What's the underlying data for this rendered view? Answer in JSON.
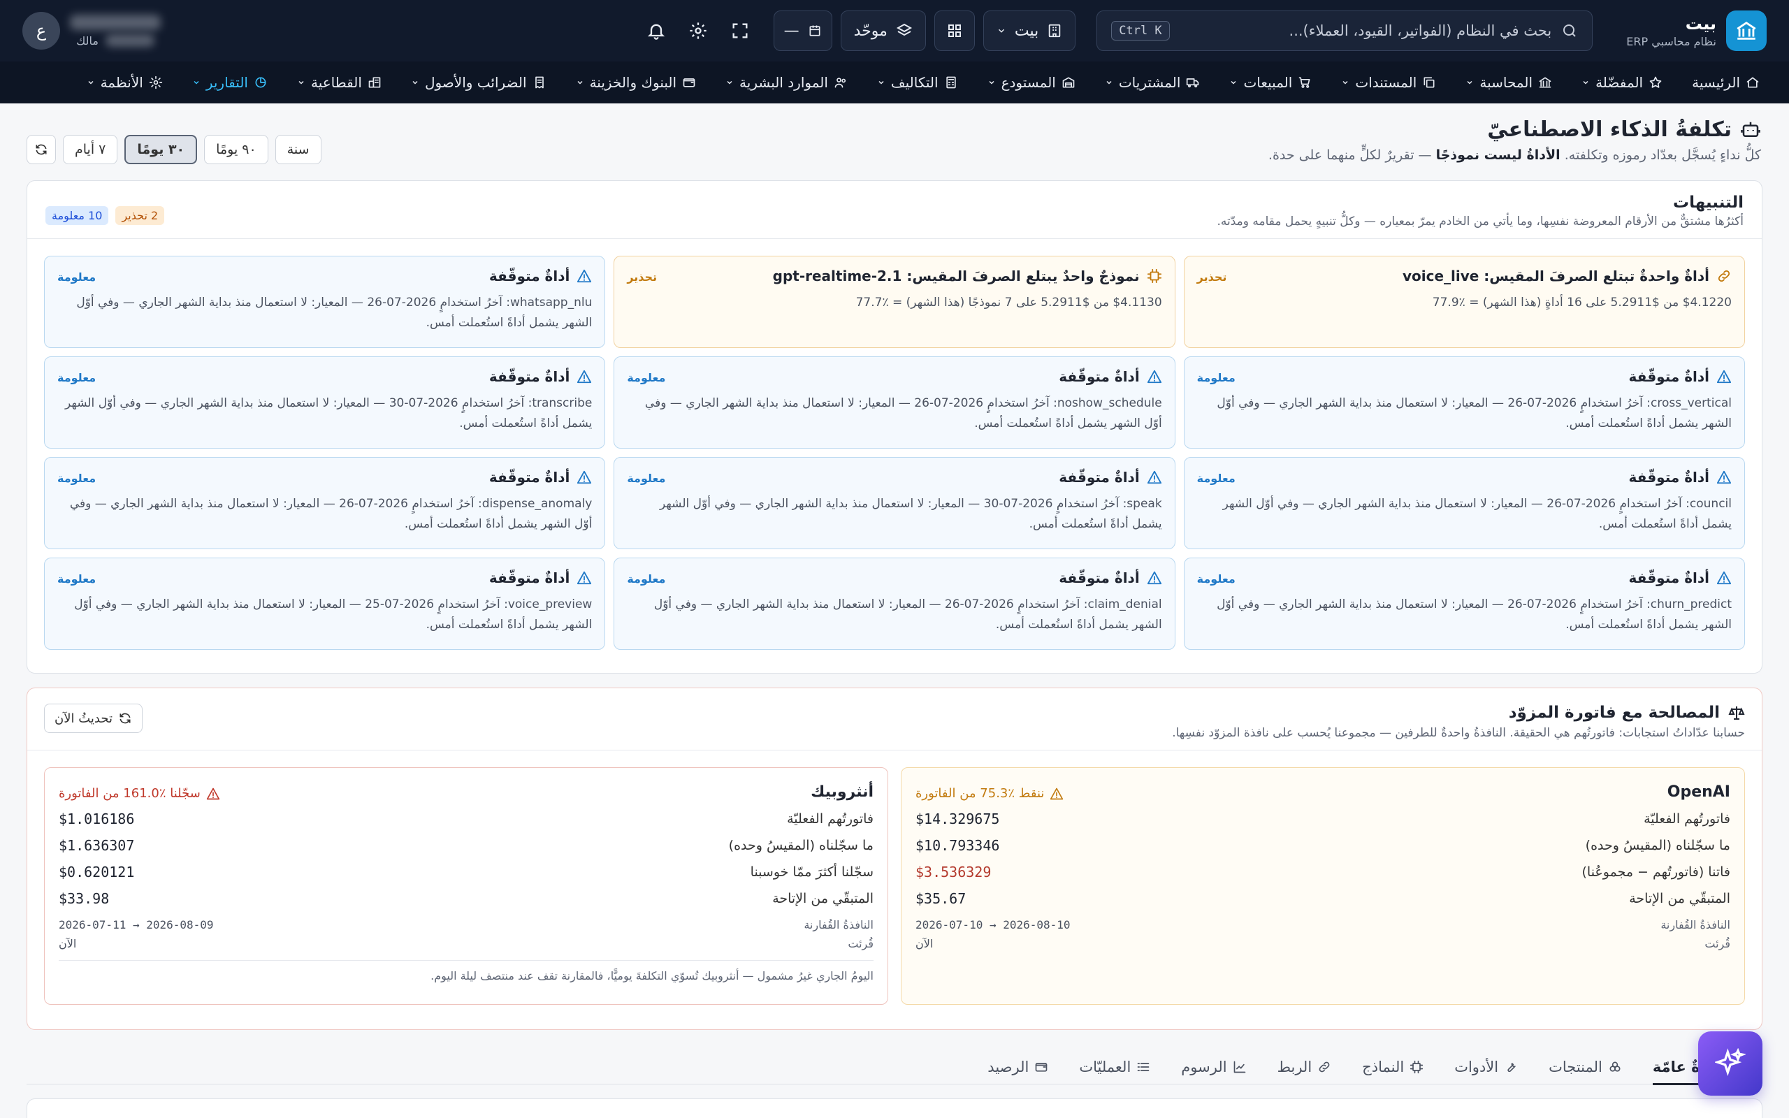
{
  "brand": {
    "name": "بيت",
    "subtitle": "نظام محاسبي ERP"
  },
  "search": {
    "placeholder": "بحث في النظام (الفواتير، القيود، العملاء)...",
    "shortcut": "Ctrl K"
  },
  "topbar": {
    "company": "بيت",
    "unified": "موحّد",
    "date_dash": "—",
    "user_role": "مالك",
    "avatar_letter": "ع"
  },
  "nav": {
    "items": [
      {
        "label": "الرئيسية",
        "icon": "home-icon"
      },
      {
        "label": "المفضّلة",
        "icon": "star-icon"
      },
      {
        "label": "المحاسبة",
        "icon": "bank-icon"
      },
      {
        "label": "المستندات",
        "icon": "copy-icon"
      },
      {
        "label": "المبيعات",
        "icon": "cart-icon"
      },
      {
        "label": "المشتريات",
        "icon": "truck-icon"
      },
      {
        "label": "المستودع",
        "icon": "warehouse-icon"
      },
      {
        "label": "التكاليف",
        "icon": "calculator-icon"
      },
      {
        "label": "الموارد البشرية",
        "icon": "users-icon"
      },
      {
        "label": "البنوك والخزينة",
        "icon": "wallet-icon"
      },
      {
        "label": "الضرائب والأصول",
        "icon": "receipt-icon"
      },
      {
        "label": "القطاعية",
        "icon": "sectors-icon"
      },
      {
        "label": "التقارير",
        "icon": "chart-pie-icon",
        "active": true
      },
      {
        "label": "الأنظمة",
        "icon": "gear-icon"
      }
    ]
  },
  "page": {
    "title": "تكلفةُ الذكاء الاصطناعيّ",
    "subtitle_pre": "كلُّ نداءٍ يُسجَّل بعدّاد رموزه وتكلفته.",
    "subtitle_bold": "الأداةُ ليست نموذجًا",
    "subtitle_post": "— تقريرٌ لكلٍّ منهما على حدة."
  },
  "ranges": {
    "items": [
      "٧ أيام",
      "٣٠ يومًا",
      "٩٠ يومًا",
      "سنة"
    ],
    "active": "٣٠ يومًا"
  },
  "alerts": {
    "title": "التنبيهات",
    "subtitle": "أكثرُها مشتقٌّ من الأرقام المعروضة نفسِها، وما يأتي من الخادم يمرّ بمعياره — وكلُّ تنبيهٍ يحمل مقامه ومدّته.",
    "warn_count": "2 تحذير",
    "info_count": "10 معلومة",
    "tag_warn": "تحذير",
    "tag_info": "معلومة",
    "items": [
      {
        "kind": "warn",
        "icon": "link-icon",
        "title": "أداةٌ واحدةٌ تبتلع الصرفَ المقيس: voice_live",
        "body": "$4.1220 من $5.2911 على 16 أداةٍ (هذا الشهر) = ٪77.9"
      },
      {
        "kind": "warn",
        "icon": "chip-icon",
        "title": "نموذجٌ واحدٌ يبتلع الصرفَ المقيس: gpt-realtime-2.1",
        "body": "$4.1130 من $5.2911 على 7 نموذجًا (هذا الشهر) = ٪77.7"
      },
      {
        "kind": "info",
        "icon": "warning-icon",
        "title": "أداةٌ متوقّفة",
        "body": "whatsapp_nlu: آخرُ استخدامٍ 2026-07-26 — المعيار: لا استعمال منذ بداية الشهر الجاري — وفي أوّل الشهر يشمل أداةً استُعملت أمس."
      },
      {
        "kind": "info",
        "icon": "warning-icon",
        "title": "أداةٌ متوقّفة",
        "body": "cross_vertical: آخرُ استخدامٍ 2026-07-26 — المعيار: لا استعمال منذ بداية الشهر الجاري — وفي أوّل الشهر يشمل أداةً استُعملت أمس."
      },
      {
        "kind": "info",
        "icon": "warning-icon",
        "title": "أداةٌ متوقّفة",
        "body": "noshow_schedule: آخرُ استخدامٍ 2026-07-26 — المعيار: لا استعمال منذ بداية الشهر الجاري — وفي أوّل الشهر يشمل أداةً استُعملت أمس."
      },
      {
        "kind": "info",
        "icon": "warning-icon",
        "title": "أداةٌ متوقّفة",
        "body": "transcribe: آخرُ استخدامٍ 2026-07-30 — المعيار: لا استعمال منذ بداية الشهر الجاري — وفي أوّل الشهر يشمل أداةً استُعملت أمس."
      },
      {
        "kind": "info",
        "icon": "warning-icon",
        "title": "أداةٌ متوقّفة",
        "body": "council: آخرُ استخدامٍ 2026-07-26 — المعيار: لا استعمال منذ بداية الشهر الجاري — وفي أوّل الشهر يشمل أداةً استُعملت أمس."
      },
      {
        "kind": "info",
        "icon": "warning-icon",
        "title": "أداةٌ متوقّفة",
        "body": "speak: آخرُ استخدامٍ 2026-07-30 — المعيار: لا استعمال منذ بداية الشهر الجاري — وفي أوّل الشهر يشمل أداةً استُعملت أمس."
      },
      {
        "kind": "info",
        "icon": "warning-icon",
        "title": "أداةٌ متوقّفة",
        "body": "dispense_anomaly: آخرُ استخدامٍ 2026-07-26 — المعيار: لا استعمال منذ بداية الشهر الجاري — وفي أوّل الشهر يشمل أداةً استُعملت أمس."
      },
      {
        "kind": "info",
        "icon": "warning-icon",
        "title": "أداةٌ متوقّفة",
        "body": "churn_predict: آخرُ استخدامٍ 2026-07-26 — المعيار: لا استعمال منذ بداية الشهر الجاري — وفي أوّل الشهر يشمل أداةً استُعملت أمس."
      },
      {
        "kind": "info",
        "icon": "warning-icon",
        "title": "أداةٌ متوقّفة",
        "body": "claim_denial: آخرُ استخدامٍ 2026-07-26 — المعيار: لا استعمال منذ بداية الشهر الجاري — وفي أوّل الشهر يشمل أداةً استُعملت أمس."
      },
      {
        "kind": "info",
        "icon": "warning-icon",
        "title": "أداةٌ متوقّفة",
        "body": "voice_preview: آخرُ استخدامٍ 2026-07-25 — المعيار: لا استعمال منذ بداية الشهر الجاري — وفي أوّل الشهر يشمل أداةً استُعملت أمس."
      }
    ]
  },
  "reconcile": {
    "title": "المصالحة مع فاتورة المزوّد",
    "subtitle": "حسابنا عدّاداتُ استجابات: فاتورتُهم هي الحقيقة. النافذةُ واحدةٌ للطرفين — مجموعنا يُحسب على نافذة المزوّد نفسِها.",
    "refresh": "تحديثُ الآن",
    "vendors": [
      {
        "name": "OpenAI",
        "kind": "oai",
        "warn": "ننقط ٪75.3 من الفاتورة",
        "rows": [
          {
            "label": "فاتورتُهم الفعليّة",
            "value": "$14.329675"
          },
          {
            "label": "ما سجّلناه (المقيسُ وحده)",
            "value": "$10.793346"
          },
          {
            "label": "فاتنا (فاتورتُهم − مجموعُنا)",
            "value": "$3.536329",
            "red": true
          },
          {
            "label": "المتبقّي من الإتاحة",
            "value": "$35.67"
          }
        ],
        "window_label": "النافذةُ القُفارنة",
        "window": "2026-07-10 → 2026-08-10",
        "read_label": "قُرئت",
        "read": "الآن"
      },
      {
        "name": "أنثروبيك",
        "kind": "ant",
        "warn": "سجّلنا ٪161.0 من الفاتورة",
        "rows": [
          {
            "label": "فاتورتُهم الفعليّة",
            "value": "$1.016186"
          },
          {
            "label": "ما سجّلناه (المقيسُ وحده)",
            "value": "$1.636307"
          },
          {
            "label": "سجّلنا أكثرَ ممّا خوسبنا",
            "value": "$0.620121"
          },
          {
            "label": "المتبقّي من الإتاحة",
            "value": "$33.98"
          }
        ],
        "window_label": "النافذةُ القُفارنة",
        "window": "2026-07-11 → 2026-08-09",
        "read_label": "قُرئت",
        "read": "الآن",
        "note": "اليومُ الجاري غيرُ مشمول — أنثروبيك تُسوّي التكلفةَ يوميًّا، فالمقارنة تقف عند منتصف ليلة اليوم."
      }
    ]
  },
  "tabs": {
    "items": [
      {
        "label": "نظرةٌ عامّة",
        "icon": "overview-icon",
        "active": true
      },
      {
        "label": "المنتجات",
        "icon": "cubes-icon"
      },
      {
        "label": "الأدوات",
        "icon": "wrench-icon"
      },
      {
        "label": "النماذج",
        "icon": "chip-icon"
      },
      {
        "label": "الربط",
        "icon": "link-icon"
      },
      {
        "label": "الرسوم",
        "icon": "chart-line-icon"
      },
      {
        "label": "العمليّات",
        "icon": "list-icon"
      },
      {
        "label": "الرصيد",
        "icon": "wallet-icon"
      }
    ]
  },
  "colors": {
    "topbar": "#111a2c",
    "nav": "#0d1524",
    "accent": "#38bdf8",
    "brand": "#1593d4",
    "warn": "#c27a0e",
    "info": "#2079c7",
    "danger": "#b43a2d"
  }
}
